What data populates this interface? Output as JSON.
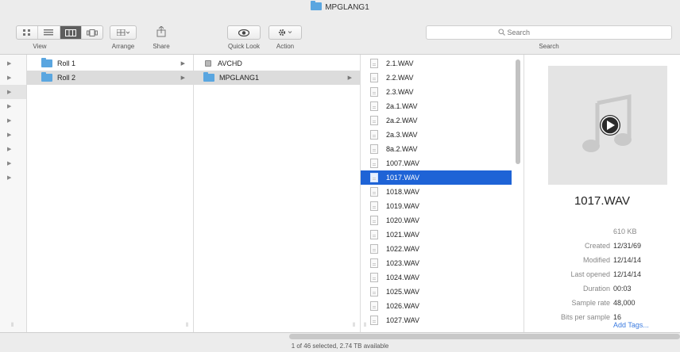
{
  "window": {
    "title": "MPGLANG1"
  },
  "toolbar": {
    "view_label": "View",
    "arrange_label": "Arrange",
    "share_label": "Share",
    "quicklook_label": "Quick Look",
    "action_label": "Action",
    "search_label": "Search",
    "search_placeholder": "Search",
    "view_modes": [
      "icon-view",
      "list-view",
      "column-view",
      "cover-flow-view"
    ],
    "active_view": "column-view"
  },
  "columns": {
    "col1": [
      {
        "name": "Roll 1",
        "icon": "folder-icon",
        "has_children": true,
        "selected": false
      },
      {
        "name": "Roll 2",
        "icon": "folder-icon",
        "has_children": true,
        "selected": true
      }
    ],
    "col2": [
      {
        "name": "AVCHD",
        "icon": "disk-icon",
        "has_children": true,
        "selected": false
      },
      {
        "name": "MPGLANG1",
        "icon": "folder-icon",
        "has_children": true,
        "selected": true
      }
    ],
    "col3": [
      "2.1.WAV",
      "2.2.WAV",
      "2.3.WAV",
      "2a.1.WAV",
      "2a.2.WAV",
      "2a.3.WAV",
      "8a.2.WAV",
      "1007.WAV",
      "1017.WAV",
      "1018.WAV",
      "1019.WAV",
      "1020.WAV",
      "1021.WAV",
      "1022.WAV",
      "1023.WAV",
      "1024.WAV",
      "1025.WAV",
      "1026.WAV",
      "1027.WAV"
    ],
    "col3_selected": "1017.WAV"
  },
  "preview": {
    "filename": "1017.WAV",
    "size": "610 KB",
    "meta": [
      {
        "key": "Created",
        "value": "12/31/69"
      },
      {
        "key": "Modified",
        "value": "12/14/14"
      },
      {
        "key": "Last opened",
        "value": "12/14/14"
      },
      {
        "key": "Duration",
        "value": "00:03"
      },
      {
        "key": "Sample rate",
        "value": "48,000"
      },
      {
        "key": "Bits per sample",
        "value": "16"
      }
    ],
    "add_tags": "Add Tags..."
  },
  "status_bar": {
    "text": "1 of 46 selected, 2.74 TB available"
  },
  "colors": {
    "selection_blue": "#1e63d6",
    "folder_blue": "#5aa6e0",
    "tags_link": "#3b7be0"
  }
}
